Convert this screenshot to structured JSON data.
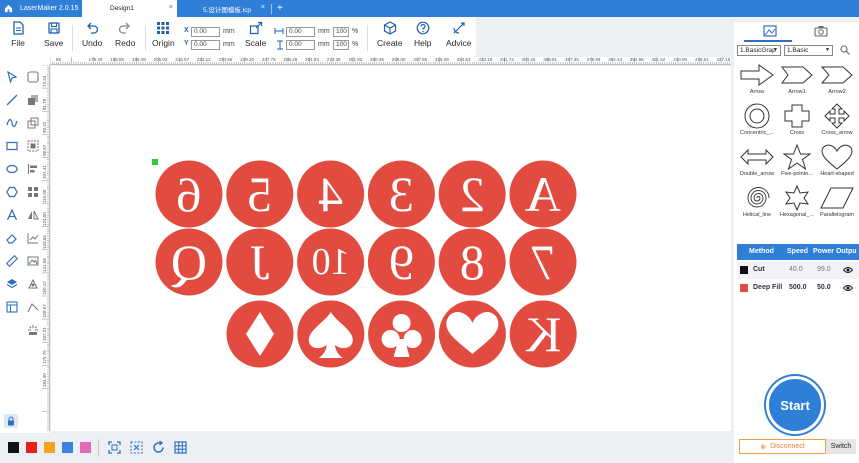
{
  "titlebar": {
    "app_name": "LaserMaker 2.0.15",
    "tabs": [
      {
        "label": "Design1",
        "active": true
      },
      {
        "label": "5.设计图模板.lcp",
        "active": false
      }
    ],
    "close_glyph": "×",
    "add_glyph": "+"
  },
  "toolbar": {
    "file": "File",
    "save": "Save",
    "undo": "Undo",
    "redo": "Redo",
    "origin": "Origin",
    "x_label": "X",
    "y_label": "Y",
    "x_value": "0.00",
    "y_value": "0.00",
    "unit": "mm",
    "scale": "Scale",
    "width_value": "0.00",
    "height_value": "0.00",
    "width_pct": "100",
    "height_pct": "100",
    "pct": "%",
    "create": "Create",
    "help": "Help",
    "advice": "Advice"
  },
  "ruler": {
    "h_ticks": [
      "86",
      "179.40",
      "188.95",
      "196.49",
      "205.03",
      "213.57",
      "222.12",
      "230.66",
      "239.20",
      "247.75",
      "256.29",
      "264.83",
      "273.38",
      "281.92",
      "290.46",
      "299.00",
      "307.55",
      "316.09",
      "324.63",
      "333.18",
      "341.72",
      "350.26",
      "358.81",
      "367.35",
      "375.89",
      "384.43",
      "392.98",
      "401.52",
      "410.06",
      "418.61",
      "427.15"
    ],
    "v_ticks": [
      "73.24",
      "81.78",
      "90.32",
      "98.87",
      "107.41",
      "115.95",
      "124.50",
      "133.04",
      "141.58",
      "150.12",
      "158.67",
      "167.21",
      "175.75",
      "184.30"
    ]
  },
  "canvas": {
    "circle_color": "#e24b3f",
    "rows": [
      [
        "6",
        "5",
        "4",
        "3",
        "2",
        "A"
      ],
      [
        "Q",
        "J",
        "10",
        "9",
        "8",
        "7"
      ],
      [
        "diamond",
        "spade",
        "club",
        "heart",
        "K"
      ]
    ]
  },
  "right_panel": {
    "category_select": "1.BasicGrap",
    "sub_select": "1.Basic",
    "shapes": [
      {
        "label": "Arrow",
        "icon": "arrow-icon"
      },
      {
        "label": "Arrow1",
        "icon": "arrow1-icon"
      },
      {
        "label": "Arrow2",
        "icon": "arrow2-icon"
      },
      {
        "label": "Concentric_...",
        "icon": "concentric-icon"
      },
      {
        "label": "Cross",
        "icon": "cross-icon"
      },
      {
        "label": "Cross_arrow",
        "icon": "cross-arrow-icon"
      },
      {
        "label": "Double_arrow",
        "icon": "double-arrow-icon"
      },
      {
        "label": "Five-pointe...",
        "icon": "star-icon"
      },
      {
        "label": "Heart-shaped",
        "icon": "heart-icon"
      },
      {
        "label": "Helical_line",
        "icon": "helix-icon"
      },
      {
        "label": "Hexagonal_...",
        "icon": "hexstar-icon"
      },
      {
        "label": "Parallelogram",
        "icon": "parallelogram-icon"
      }
    ],
    "layer_headers": {
      "method": "Method",
      "speed": "Speed",
      "power": "Power Outpu"
    },
    "layers": [
      {
        "name": "Cut",
        "speed": "40.0",
        "power": "99.0",
        "color": "#111111"
      },
      {
        "name": "Deep Fill",
        "speed": "500.0",
        "power": "50.0",
        "color": "#e24b3f"
      }
    ],
    "start": "Start",
    "disconnect": "Disconnect",
    "switch": "Switch"
  },
  "bottom_bar": {
    "swatches": [
      "#111111",
      "#e8201c",
      "#f5a31a",
      "#3b82e0",
      "#e46cb6"
    ]
  },
  "colors": {
    "accent": "#2f7fd8",
    "circle": "#e24b3f"
  }
}
